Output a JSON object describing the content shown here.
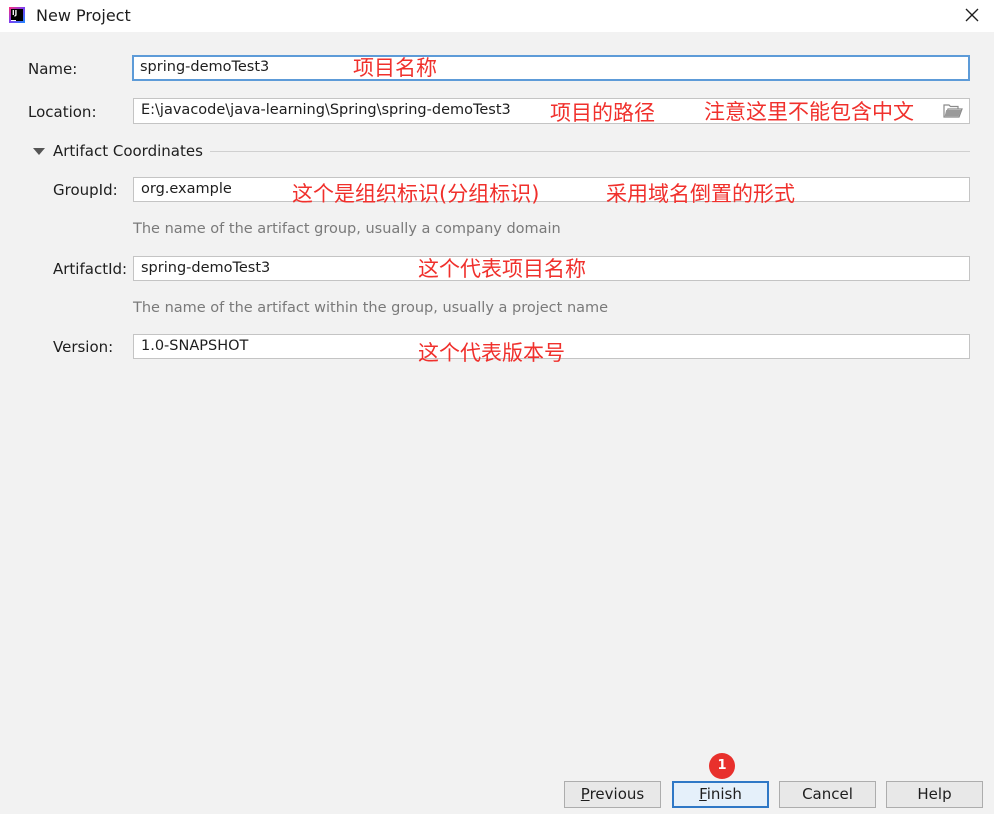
{
  "window": {
    "title": "New Project",
    "app_icon_text": "IJ"
  },
  "form": {
    "name": {
      "label": "Name:",
      "value": "spring-demoTest3",
      "annotation": "项目名称"
    },
    "location": {
      "label": "Location:",
      "value": "E:\\javacode\\java-learning\\Spring\\spring-demoTest3",
      "annotation": "项目的路径",
      "annotation2": "注意这里不能包含中文"
    },
    "artifact_section": {
      "title": "Artifact Coordinates",
      "expanded": true
    },
    "group_id": {
      "label": "GroupId:",
      "value": "org.example",
      "annotation": "这个是组织标识(分组标识)",
      "annotation2": "采用域名倒置的形式",
      "hint": "The name of the artifact group, usually a company domain"
    },
    "artifact_id": {
      "label": "ArtifactId:",
      "value": "spring-demoTest3",
      "annotation": "这个代表项目名称",
      "hint": "The name of the artifact within the group, usually a project name"
    },
    "version": {
      "label": "Version:",
      "value": "1.0-SNAPSHOT",
      "annotation": "这个代表版本号"
    }
  },
  "buttons": {
    "previous_mnemonic": "P",
    "previous_rest": "revious",
    "finish_mnemonic": "F",
    "finish_rest": "inish",
    "cancel": "Cancel",
    "help": "Help"
  },
  "step_badge": "1",
  "colors": {
    "annotation": "#f0302c",
    "focus_border": "#5d9bd8",
    "default_button_border": "#2f78c6",
    "badge": "#e8302c"
  },
  "icons": {
    "close": "close-icon",
    "folder": "folder-icon",
    "expand": "triangle-down-icon"
  }
}
